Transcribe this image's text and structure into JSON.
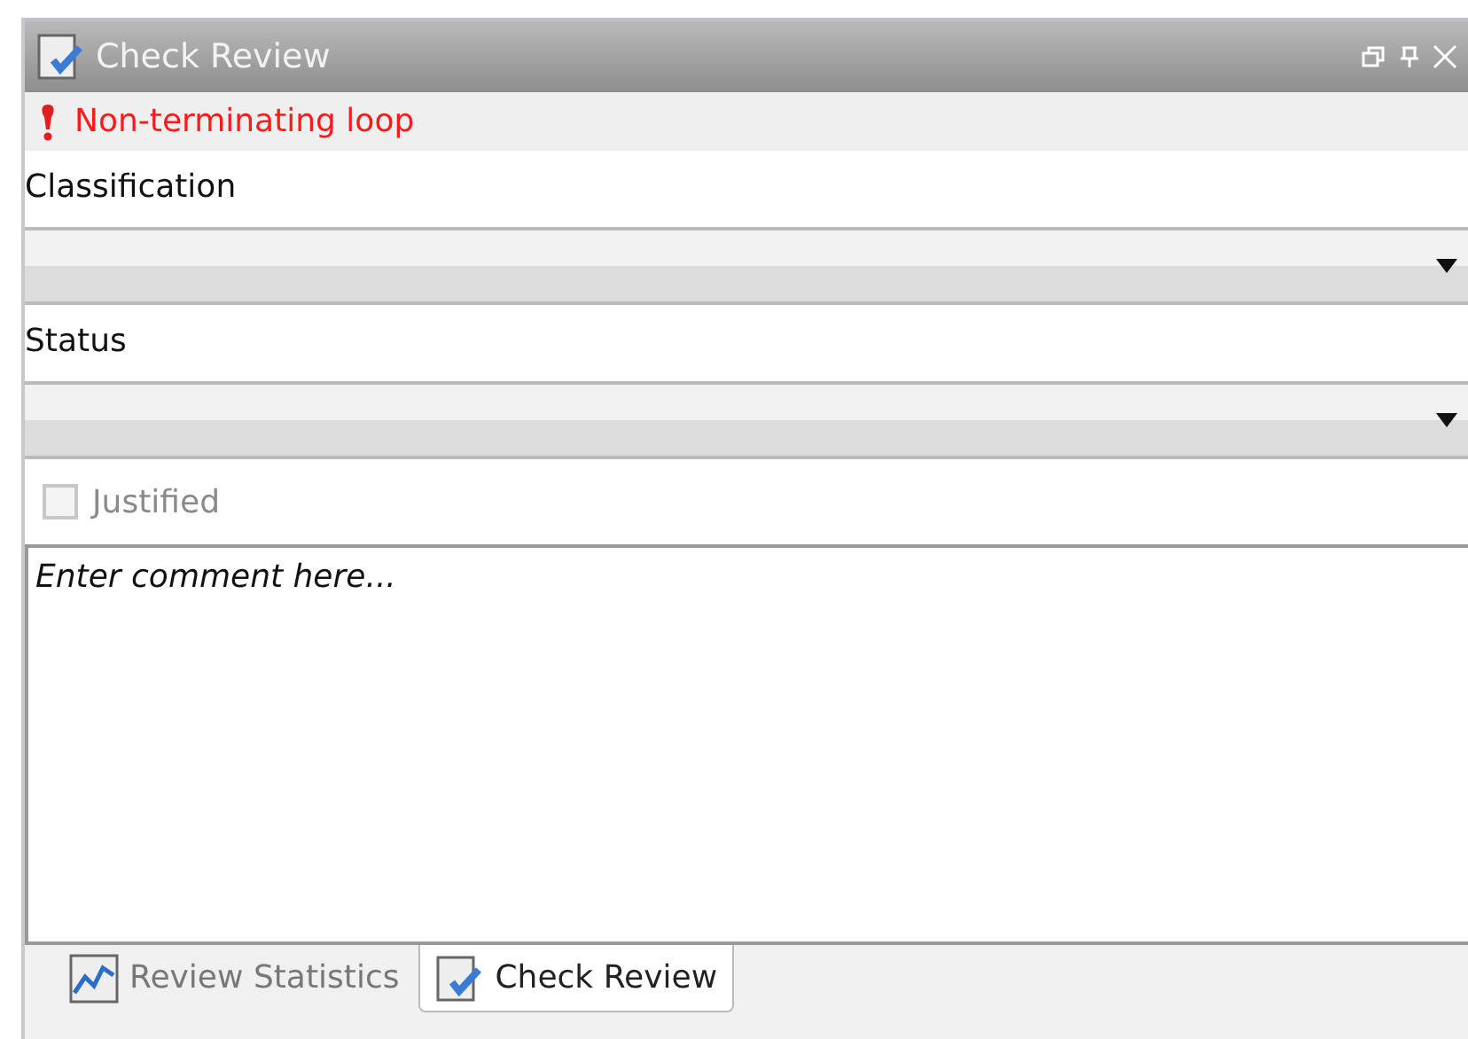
{
  "window": {
    "title": "Check Review"
  },
  "warning": {
    "text": "Non-terminating loop"
  },
  "fields": [
    {
      "label": "Classification"
    },
    {
      "label": "Status"
    }
  ],
  "justified": {
    "label": "Justified",
    "checked": false,
    "disabled": true
  },
  "comment": {
    "placeholder": "Enter comment here..."
  },
  "tabs": [
    {
      "label": "Review Statistics",
      "kind": "chart",
      "selected": false
    },
    {
      "label": "Check Review",
      "kind": "check",
      "selected": true
    }
  ]
}
